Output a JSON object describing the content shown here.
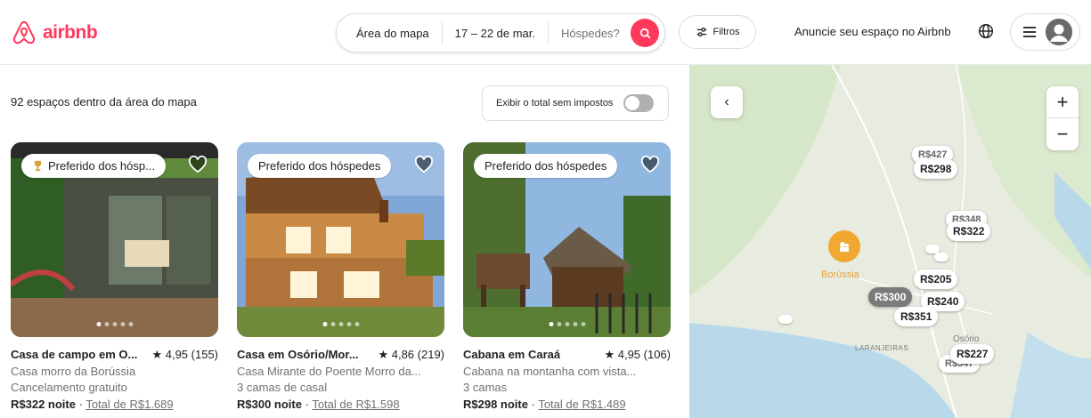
{
  "header": {
    "logo_text": "airbnb",
    "search": {
      "area": "Área do mapa",
      "dates": "17 – 22 de mar.",
      "guests_placeholder": "Hóspedes?"
    },
    "filters_label": "Filtros",
    "host_link": "Anuncie seu espaço no Airbnb"
  },
  "results": {
    "count_text": "92 espaços dentro da área do mapa",
    "tax_toggle_label": "Exibir o total sem impostos",
    "tax_toggle_on": false
  },
  "listings": [
    {
      "badge": "Preferido dos hósp...",
      "title": "Casa de campo em O...",
      "rating": "★ 4,95 (155)",
      "subtitle": "Casa morro da Borússia",
      "detail": "Cancelamento gratuito",
      "price": "R$322 noite",
      "separator": " · ",
      "total": "Total de R$1.689"
    },
    {
      "badge": "Preferido dos hóspedes",
      "title": "Casa em Osório/Mor...",
      "rating": "★ 4,86 (219)",
      "subtitle": "Casa Mirante do Poente Morro da...",
      "detail": "3 camas de casal",
      "price": "R$300 noite",
      "separator": " · ",
      "total": "Total de R$1.598"
    },
    {
      "badge": "Preferido dos hóspedes",
      "title": "Cabana em Caraá",
      "rating": "★ 4,95 (106)",
      "subtitle": "Cabana na montanha com vista...",
      "detail": "3 camas",
      "price": "R$298 noite",
      "separator": " · ",
      "total": "Total de R$1.489"
    }
  ],
  "map": {
    "back_label": "‹",
    "zoom_in": "+",
    "zoom_out": "−",
    "poi_label": "Borússia",
    "places": [
      "LARANJEIRAS",
      "Osório"
    ],
    "pins": [
      "R$427",
      "R$298",
      "R$348",
      "R$322",
      "R$205",
      "R$300",
      "R$240",
      "R$351",
      "R$347",
      "R$227"
    ]
  },
  "colors": {
    "brand": "#ff385c",
    "map_land": "#e8ece0",
    "map_green": "#d3e8c8",
    "map_water": "#b9d9ea",
    "poi": "#f0a830"
  }
}
